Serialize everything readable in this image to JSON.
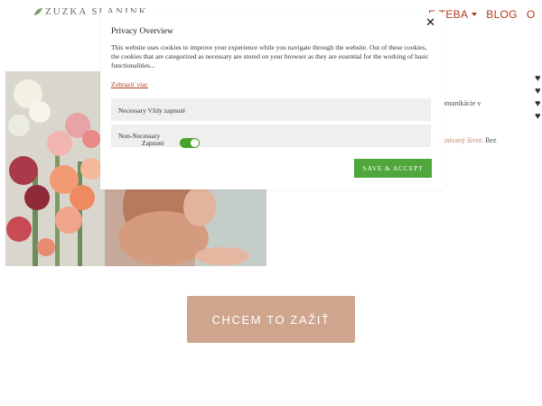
{
  "header": {
    "logo_text": "ZUZKA SLANINK",
    "nav": [
      {
        "label": "E TEBA",
        "has_dropdown": true
      },
      {
        "label": "BLOG",
        "has_dropdown": false
      },
      {
        "label": "O",
        "has_dropdown": false
      }
    ]
  },
  "content": {
    "side_text_1": "e a komunikácie v",
    "side_text_2_highlight": "oj vysnívaný život.",
    "side_text_2_rest": " Bez",
    "cta_label": "CHCEM TO ZAŽIŤ"
  },
  "cookie_modal": {
    "title": "Privacy Overview",
    "body": "This website uses cookies to improve your experience while you navigate through the website. Out of these cookies, the cookies that are categorized as necessary are stored on your browser as they are essential for the working of basic functionalities...",
    "show_more": "Zobraziť viac",
    "rows": [
      {
        "label": "Necessary Vždy zapnuté"
      },
      {
        "label": "Non-Necessary",
        "sublabel": "Zapnuté",
        "toggle_on": true
      }
    ],
    "save_label": "SAVE & ACCEPT"
  },
  "colors": {
    "accent": "#b23b1c",
    "cta": "#cfa58e",
    "toggle_on": "#47a42b",
    "save_button": "#4fa63a"
  }
}
